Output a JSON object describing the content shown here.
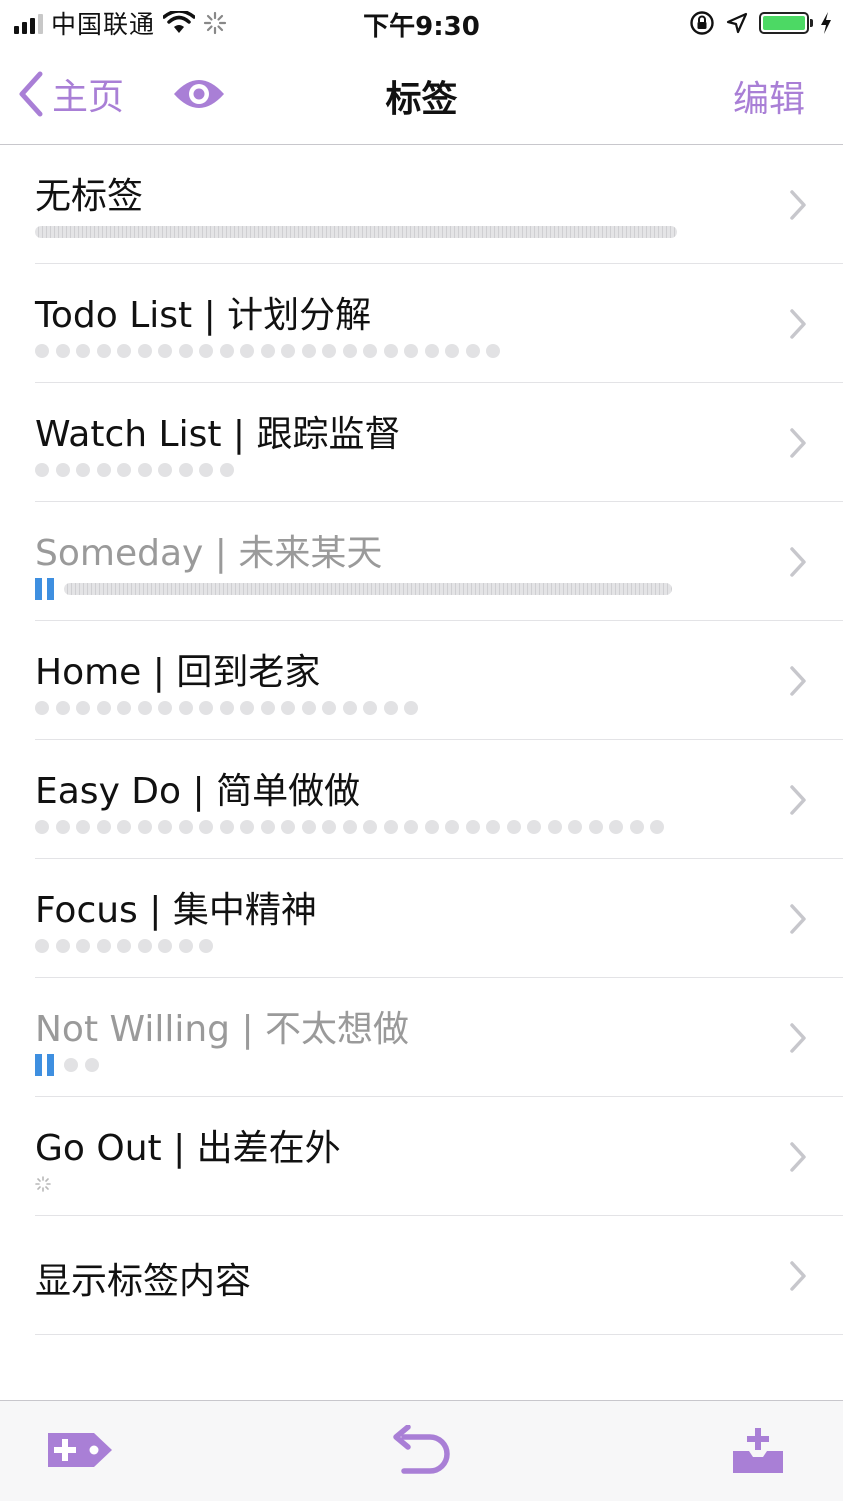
{
  "status_bar": {
    "carrier": "中国联通",
    "time": "下午9:30",
    "battery_level": 1.0
  },
  "nav": {
    "back_label": "主页",
    "title": "标签",
    "edit_label": "编辑"
  },
  "tags": [
    {
      "label": "无标签"
    },
    {
      "label": "Todo List | 计划分解"
    },
    {
      "label": "Watch List | 跟踪监督"
    },
    {
      "label": "Someday | 未来某天"
    },
    {
      "label": "Home | 回到老家"
    },
    {
      "label": "Easy Do | 简单做做"
    },
    {
      "label": "Focus | 集中精神"
    },
    {
      "label": "Not Willing | 不太想做"
    },
    {
      "label": "Go Out | 出差在外"
    },
    {
      "label": "显示标签内容"
    }
  ],
  "colors": {
    "accent": "#a97fd6",
    "progress_blue": "#3e8fe0",
    "dot_gray": "#e2e2e4"
  },
  "toolbar": {
    "icons": [
      "add-tag-icon",
      "undo-icon",
      "inbox-upload-icon"
    ]
  }
}
